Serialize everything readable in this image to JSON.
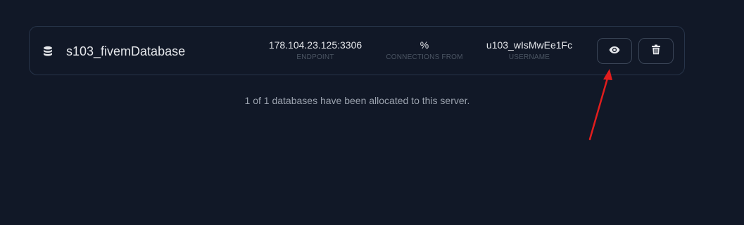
{
  "database": {
    "icon": "database-icon",
    "name": "s103_fivemDatabase",
    "endpoint": {
      "value": "178.104.23.125:3306",
      "label": "ENDPOINT"
    },
    "connections_from": {
      "value": "%",
      "label": "CONNECTIONS FROM"
    },
    "username": {
      "value": "u103_wIsMwEe1Fc",
      "label": "USERNAME"
    },
    "actions": [
      {
        "name": "view",
        "icon": "eye-icon"
      },
      {
        "name": "delete",
        "icon": "trash-icon"
      }
    ]
  },
  "footer": {
    "text": "1 of 1 databases have been allocated to this server."
  },
  "annotation": {
    "color": "#e11d1d",
    "target": "view-button"
  }
}
